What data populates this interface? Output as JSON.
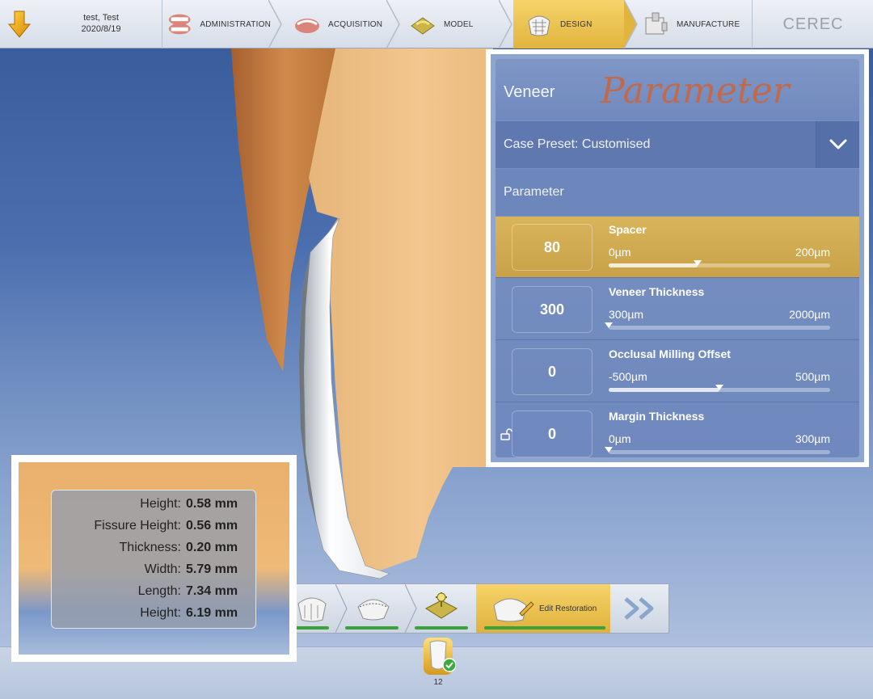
{
  "patient": {
    "name": "test, Test",
    "date": "2020/8/19"
  },
  "phases": [
    {
      "label": "ADMINISTRATION",
      "icon": "administration-icon",
      "active": false
    },
    {
      "label": "ACQUISITION",
      "icon": "acquisition-icon",
      "active": false
    },
    {
      "label": "MODEL",
      "icon": "model-icon",
      "active": false
    },
    {
      "label": "DESIGN",
      "icon": "design-icon",
      "active": true
    },
    {
      "label": "MANUFACTURE",
      "icon": "manufacture-icon",
      "active": false
    }
  ],
  "brand": "CEREC",
  "panel": {
    "title": "Veneer",
    "watermark": "Parameter",
    "case_preset": "Case Preset: Customised",
    "section": "Parameter",
    "params": [
      {
        "name": "Spacer",
        "value": "80",
        "min": "0µm",
        "max": "200µm",
        "fraction": 0.4,
        "selected": true,
        "locked": false
      },
      {
        "name": "Veneer Thickness",
        "value": "300",
        "min": "300µm",
        "max": "2000µm",
        "fraction": 0.0,
        "selected": false,
        "locked": false
      },
      {
        "name": "Occlusal Milling Offset",
        "value": "0",
        "min": "-500µm",
        "max": "500µm",
        "fraction": 0.5,
        "selected": false,
        "locked": false
      },
      {
        "name": "Margin Thickness",
        "value": "0",
        "min": "0µm",
        "max": "300µm",
        "fraction": 0.0,
        "selected": false,
        "locked": true
      }
    ]
  },
  "measurements": [
    {
      "label": "Height:",
      "value": "0.58 mm"
    },
    {
      "label": "Fissure Height:",
      "value": "0.56 mm"
    },
    {
      "label": "Thickness:",
      "value": "0.20 mm"
    },
    {
      "label": "Width:",
      "value": "5.79 mm"
    },
    {
      "label": "Length:",
      "value": "7.34 mm"
    },
    {
      "label": "Height:",
      "value": "6.19 mm"
    }
  ],
  "workflow": {
    "active_label": "Edit Restoration"
  },
  "restoration": {
    "tooth_number": "12"
  },
  "colors": {
    "active_phase": "#e6b843",
    "selected_row": "#d2ac50",
    "panel_blue": "#6f88bd",
    "progress_green": "#3ba13b",
    "watermark": "#c0694b"
  }
}
